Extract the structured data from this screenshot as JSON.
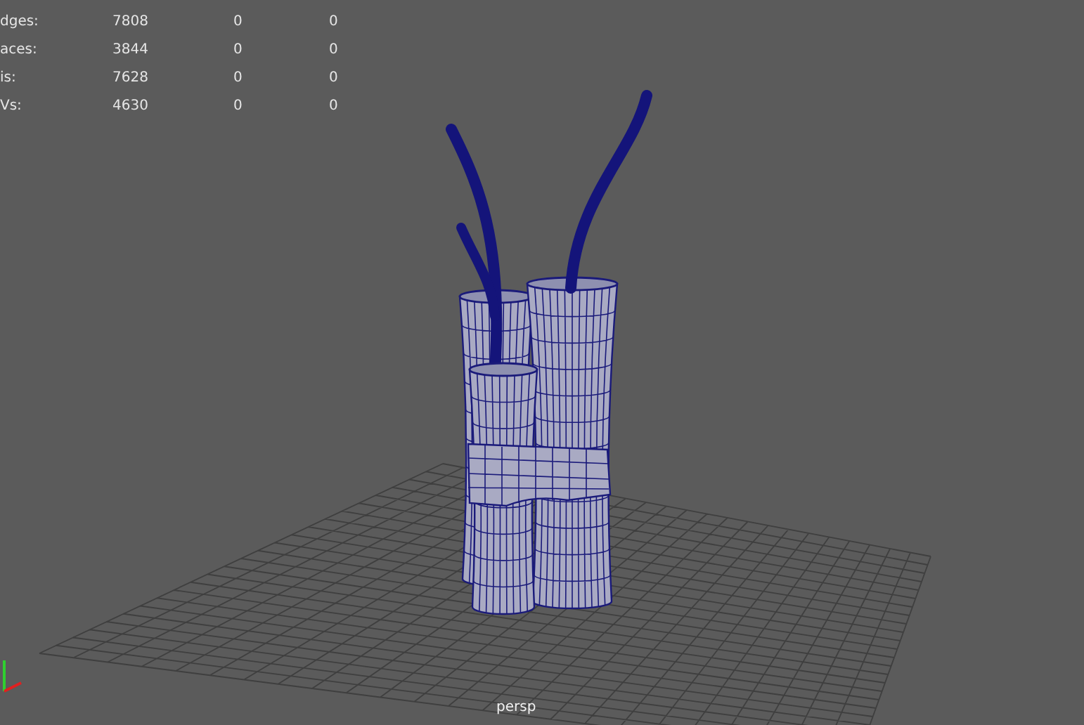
{
  "hud": {
    "rows": [
      {
        "label": "dges:",
        "values": [
          "7808",
          "0",
          "0"
        ]
      },
      {
        "label": "aces:",
        "values": [
          "3844",
          "0",
          "0"
        ]
      },
      {
        "label": "is:",
        "values": [
          "7628",
          "0",
          "0"
        ]
      },
      {
        "label": "Vs:",
        "values": [
          "4630",
          "0",
          "0"
        ]
      }
    ]
  },
  "camera": {
    "label": "persp"
  }
}
